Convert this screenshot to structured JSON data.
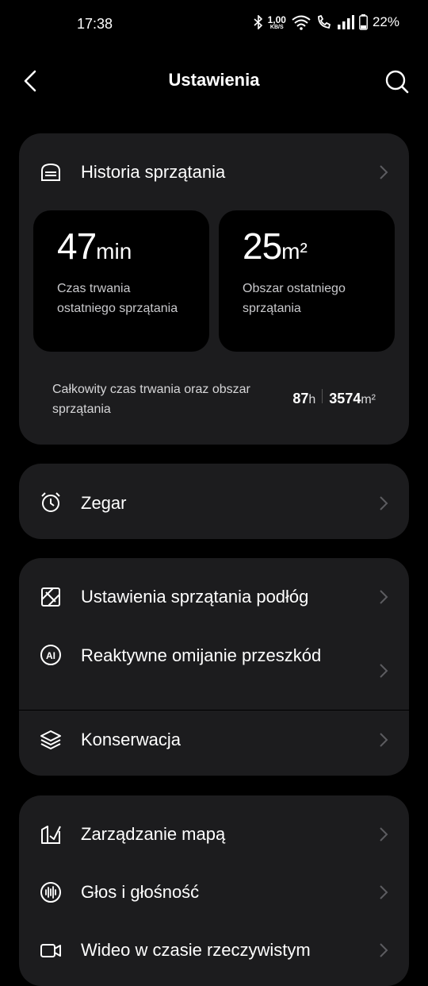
{
  "status_bar": {
    "time": "17:38",
    "speed_value": "1,00",
    "speed_unit": "KB/S",
    "battery": "22%"
  },
  "header": {
    "title": "Ustawienia"
  },
  "history_card": {
    "title": "Historia sprzątania",
    "last_duration": {
      "value": "47",
      "unit": "min",
      "label": "Czas trwania ostatniego sprzątania"
    },
    "last_area": {
      "value": "25",
      "unit": "m²",
      "label": "Obszar ostatniego sprzątania"
    },
    "total_label": "Całkowity czas trwania oraz obszar sprzątania",
    "total_hours": "87",
    "total_hours_unit": "h",
    "total_area": "3574",
    "total_area_unit": "m²"
  },
  "clock_card": {
    "label": "Zegar"
  },
  "cleaning_card": {
    "items": [
      {
        "label": "Ustawienia sprzątania podłóg",
        "icon": "floor-icon"
      },
      {
        "label": "Reaktywne omijanie przeszkód",
        "icon": "ai-icon"
      },
      {
        "label": "Konserwacja",
        "icon": "layers-icon"
      }
    ]
  },
  "map_card": {
    "items": [
      {
        "label": "Zarządzanie mapą",
        "icon": "map-icon"
      },
      {
        "label": "Głos i głośność",
        "icon": "voice-icon"
      },
      {
        "label": "Wideo w czasie rzeczywistym",
        "icon": "video-icon"
      }
    ]
  }
}
